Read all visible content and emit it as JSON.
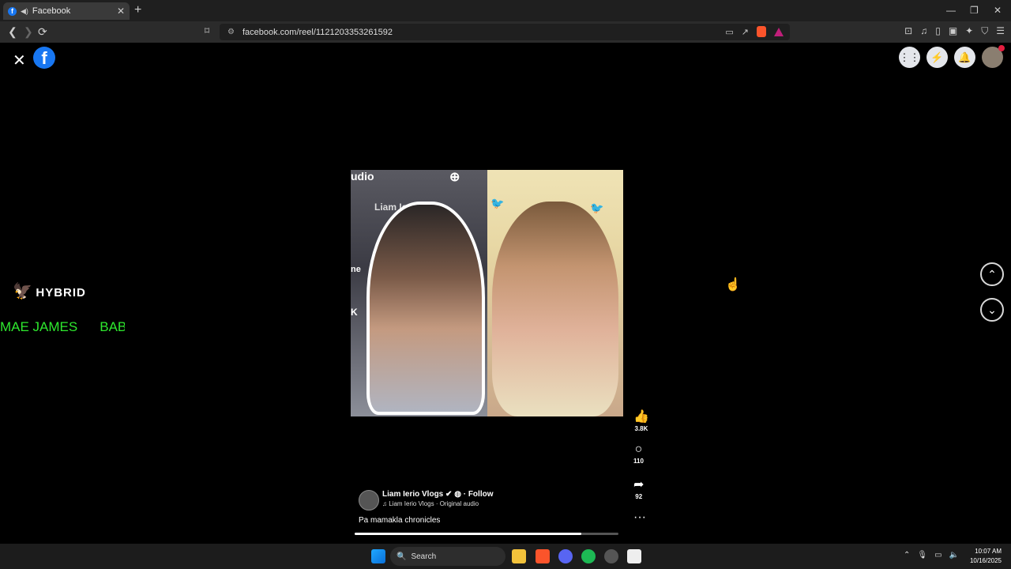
{
  "browser": {
    "tab": {
      "title": "Facebook",
      "close": "✕"
    },
    "new_tab": "+",
    "url": "facebook.com/reel/1121203353261592",
    "window_controls": [
      "—",
      "❐",
      "✕"
    ]
  },
  "facebook": {
    "logo": "f",
    "close": "✕",
    "top_icons": [
      "menu-grid-icon",
      "messenger-icon",
      "notifications-icon",
      "profile-avatar"
    ]
  },
  "overlay": {
    "brand": "HYBRID",
    "ticker": [
      "MAE JAMES",
      "BABY M"
    ]
  },
  "video": {
    "top_text": "udio",
    "left_name": "Liam Ierio TV",
    "left_label1": "ne",
    "left_label2": "K"
  },
  "actions": {
    "likes": "3.8K",
    "comments": "110",
    "shares": "92",
    "more": "···"
  },
  "post": {
    "author": "Liam Ierio Vlogs",
    "follow": "Follow",
    "audio": "Liam Ierio Vlogs · Original audio",
    "caption": "Pa mamakla chronicles",
    "progress": 0.86
  },
  "taskbar": {
    "search": "Search",
    "time": "10:07 AM",
    "date": "10/16/2025"
  }
}
